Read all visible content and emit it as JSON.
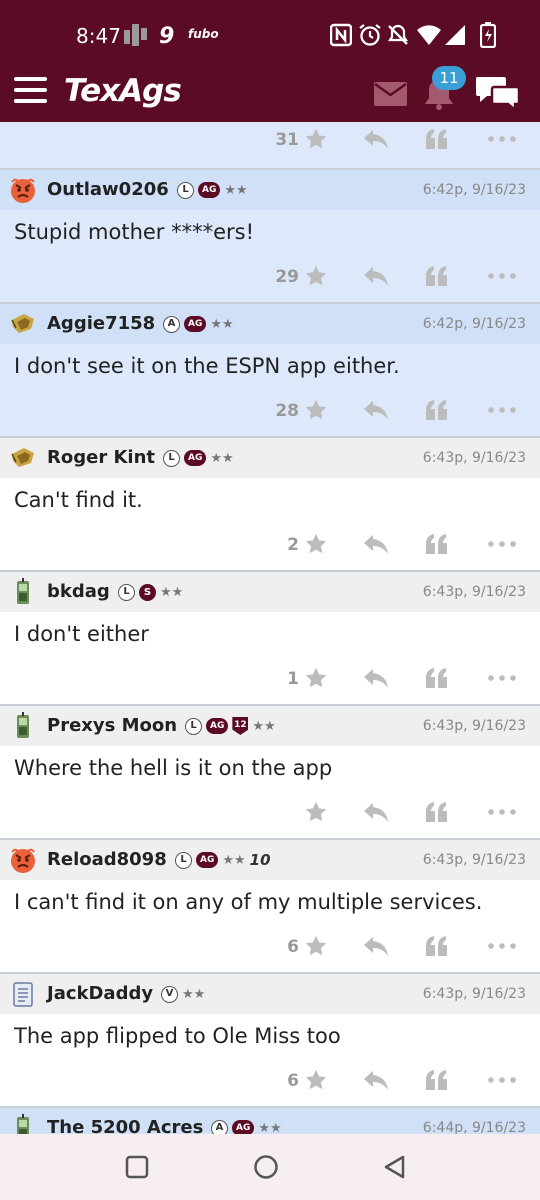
{
  "status_bar": {
    "time": "8:47",
    "left_icons": [
      "grid-app-icon",
      "nine-app-icon",
      "fubo-app-icon"
    ],
    "fubo_text": "fubo",
    "right_icons": [
      "nfc-icon",
      "alarm-icon",
      "mute-icon",
      "wifi-icon",
      "signal-icon",
      "battery-icon"
    ]
  },
  "app_bar": {
    "logo": "TexAgs",
    "notification_count": "11"
  },
  "colors": {
    "brand": "#5b0c24",
    "highlight_row": "#dde9fa",
    "badge_blue": "#3a9fd6"
  },
  "partial_top_post": {
    "likes": "31"
  },
  "posts": [
    {
      "user": "Outlaw0206",
      "avatar": "angry-face-icon",
      "badges": [
        "L",
        "AG",
        "★★"
      ],
      "time": "6:42p, 9/16/23",
      "text": "Stupid mother ****ers!",
      "likes": "29",
      "highlighted": true
    },
    {
      "user": "Aggie7158",
      "avatar": "ag-ring-icon",
      "badges": [
        "A",
        "AG",
        "★★"
      ],
      "time": "6:42p, 9/16/23",
      "text": "I don't see it on the ESPN app either.",
      "likes": "28",
      "highlighted": true
    },
    {
      "user": "Roger Kint",
      "avatar": "ag-ring-icon",
      "badges": [
        "L",
        "AG",
        "★★"
      ],
      "time": "6:43p, 9/16/23",
      "text": "Can't find it.",
      "likes": "2",
      "highlighted": false
    },
    {
      "user": "bkdag",
      "avatar": "phone-icon",
      "badges": [
        "L",
        "S",
        "★★"
      ],
      "time": "6:43p, 9/16/23",
      "text": "I don't either",
      "likes": "1",
      "highlighted": false
    },
    {
      "user": "Prexys Moon",
      "avatar": "phone-icon",
      "badges": [
        "L",
        "AG",
        "12",
        "★★"
      ],
      "time": "6:43p, 9/16/23",
      "text": "Where the hell is it on the app",
      "likes": "",
      "highlighted": false
    },
    {
      "user": "Reload8098",
      "avatar": "angry-face-icon",
      "badges": [
        "L",
        "AG",
        "★★",
        "10"
      ],
      "time": "6:43p, 9/16/23",
      "text": "I can't find it on any of my multiple services.",
      "likes": "6",
      "highlighted": false
    },
    {
      "user": "JackDaddy",
      "avatar": "notepad-icon",
      "badges": [
        "V",
        "★★"
      ],
      "time": "6:43p, 9/16/23",
      "text": "The app flipped to Ole Miss too",
      "likes": "6",
      "highlighted": false
    },
    {
      "user": "The 5200 Acres",
      "avatar": "phone-icon",
      "badges": [
        "A",
        "AG",
        "★★"
      ],
      "time": "6:44p, 9/16/23",
      "text": "",
      "likes": "",
      "highlighted": true
    }
  ]
}
